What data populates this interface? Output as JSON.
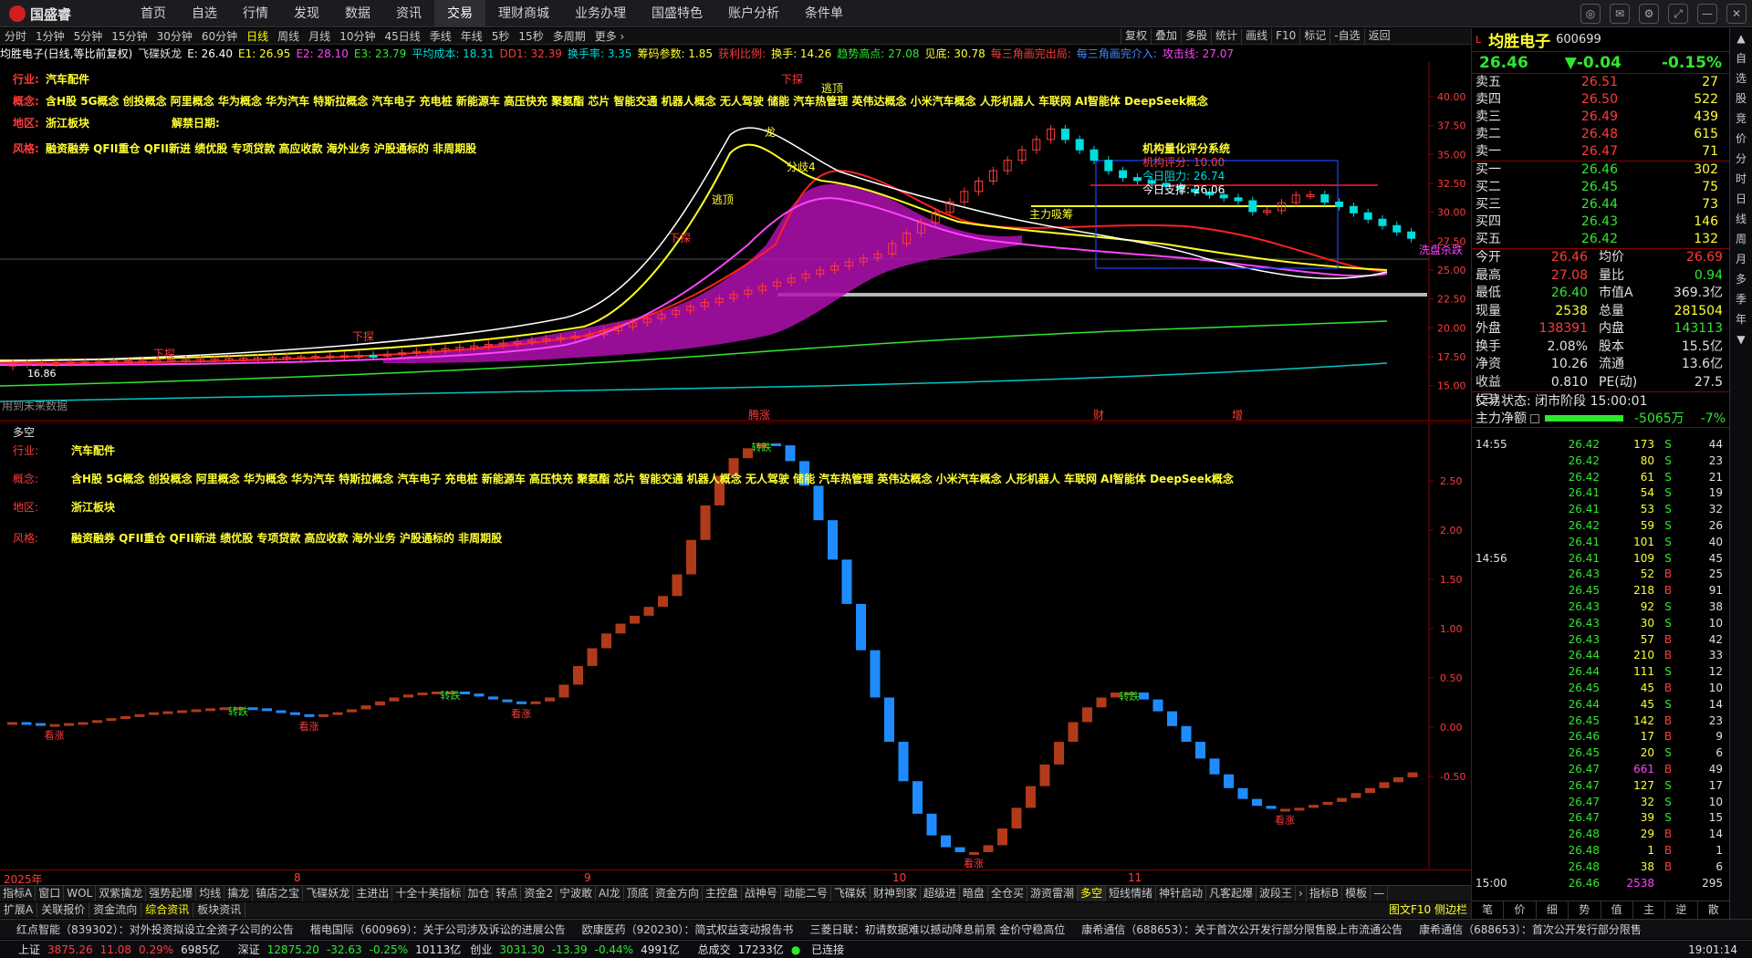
{
  "app": {
    "logo": "国盛睿"
  },
  "nav": {
    "items": [
      "首页",
      "自选",
      "行情",
      "发现",
      "数据",
      "资讯",
      "交易",
      "理财商城",
      "业务办理",
      "国盛特色",
      "账户分析",
      "条件单"
    ],
    "active_index": 6
  },
  "window_controls": [
    "◎",
    "✉",
    "⚙",
    "⤢",
    "—",
    "✕"
  ],
  "periods": {
    "items": [
      "分时",
      "1分钟",
      "5分钟",
      "15分钟",
      "30分钟",
      "60分钟",
      "日线",
      "周线",
      "月线",
      "10分钟",
      "45日线",
      "季线",
      "年线",
      "5秒",
      "15秒",
      "多周期",
      "更多 ›"
    ],
    "active_index": 6
  },
  "right_tools": [
    "复权",
    "叠加",
    "多股",
    "统计",
    "画线",
    "F10",
    "标记",
    "-自选",
    "返回"
  ],
  "indicator_line": [
    {
      "text": "均胜电子(日线,等比前复权)",
      "color": "#ffffff"
    },
    {
      "text": "飞碟妖龙",
      "color": "#e0e0e0"
    },
    {
      "text": "E: 26.40",
      "color": "#ffffff"
    },
    {
      "text": "E1: 26.95",
      "color": "#ffff33"
    },
    {
      "text": "E2: 28.10",
      "color": "#ff44ff"
    },
    {
      "text": "E3: 23.79",
      "color": "#2ee82e"
    },
    {
      "text": "平均成本: 18.31",
      "color": "#00dddd"
    },
    {
      "text": "DD1: 32.39",
      "color": "#ff3b3b"
    },
    {
      "text": "换手率: 3.35",
      "color": "#00dddd"
    },
    {
      "text": "筹码参数: 1.85",
      "color": "#ffff33"
    },
    {
      "text": "获利比例:",
      "color": "#ff3b3b"
    },
    {
      "text": "换手: 14.26",
      "color": "#ffff33"
    },
    {
      "text": "趋势高点: 27.08",
      "color": "#2ee82e"
    },
    {
      "text": "见底: 30.78",
      "color": "#ffff33"
    },
    {
      "text": "每三角画完出局:",
      "color": "#ff3b3b"
    },
    {
      "text": "每三角画完介入:",
      "color": "#4488ff"
    },
    {
      "text": "攻击线: 27.07",
      "color": "#ff44ff"
    }
  ],
  "info": {
    "industry_label": "行业:",
    "industry": "汽车配件",
    "concept_label": "概念:",
    "concepts": "含H股 5G概念 创投概念 阿里概念 华为概念 华为汽车 特斯拉概念 汽车电子 充电桩 新能源车 高压快充 聚氨酯 芯片 智能交通 机器人概念 无人驾驶 储能 汽车热管理 英伟达概念 小米汽车概念 人形机器人 车联网 AI智能体 DeepSeek概念",
    "region_label": "地区:",
    "region": "浙江板块",
    "unlock_label": "解禁日期:",
    "style_label": "风格:",
    "style": "融资融券 QFII重仓 QFII新进 绩优股 专项贷款 高应收款 海外业务 沪股通标的 非周期股"
  },
  "main_annotations": {
    "score_title": "机构量化评分系统",
    "score_line": "机构评分: 10.00",
    "resist": "今日阻力: 26.74",
    "support": "今日支撑: 26.06",
    "main_absorb": "主力吸筹",
    "wash": "洗盘杀跌",
    "no_data": "用到未来数据",
    "low_price": "16.86",
    "down_tag": "下探",
    "escape": "逃顶",
    "dragon": "龙",
    "divide": "分歧4",
    "limit_up": "涨停",
    "events": [
      "腾涨",
      "财",
      "增"
    ]
  },
  "main_axis": {
    "ticks": [
      40.0,
      37.5,
      35.0,
      32.5,
      30.0,
      27.5,
      25.0,
      22.5,
      20.0,
      17.5,
      15.0
    ],
    "labels": [
      "40.00",
      "37.50",
      "35.00",
      "32.50",
      "30.00",
      "27.50",
      "25.00",
      "22.50",
      "20.00",
      "17.50",
      "15.00"
    ]
  },
  "pane2": {
    "title": "多空",
    "axis_labels": [
      "2.50",
      "2.00",
      "1.50",
      "1.00",
      "0.50",
      "0.00",
      "-0.50"
    ],
    "bull_label": "转跌",
    "bear_label": "看涨"
  },
  "chart_data": {
    "type": "bar",
    "title": "多空",
    "x": [
      "2025年",
      "8",
      "9",
      "10",
      "11"
    ],
    "ylim": [
      -1.4,
      3.0
    ],
    "series": [
      {
        "values": [
          0.05,
          0.04,
          0.03,
          0.03,
          0.04,
          0.05,
          0.07,
          0.09,
          0.11,
          0.13,
          0.15,
          0.16,
          0.17,
          0.18,
          0.19,
          0.2,
          0.2,
          0.19,
          0.17,
          0.15,
          0.13,
          0.12,
          0.13,
          0.15,
          0.18,
          0.22,
          0.26,
          0.3,
          0.33,
          0.35,
          0.36,
          0.36,
          0.34,
          0.31,
          0.28,
          0.26,
          0.25,
          0.26,
          0.3,
          0.43,
          0.62,
          0.8,
          0.95,
          1.05,
          1.13,
          1.22,
          1.33,
          1.55,
          1.9,
          2.25,
          2.55,
          2.73,
          2.83,
          2.88,
          2.86,
          2.7,
          2.45,
          2.1,
          1.7,
          1.25,
          0.78,
          0.3,
          -0.15,
          -0.55,
          -0.88,
          -1.1,
          -1.22,
          -1.27,
          -1.27,
          -1.2,
          -1.03,
          -0.82,
          -0.6,
          -0.38,
          -0.15,
          0.05,
          0.2,
          0.3,
          0.35,
          0.35,
          0.28,
          0.16,
          0.01,
          -0.15,
          -0.32,
          -0.48,
          -0.62,
          -0.73,
          -0.8,
          -0.83,
          -0.83,
          -0.82,
          -0.79,
          -0.76,
          -0.72,
          -0.67,
          -0.62,
          -0.56,
          -0.51,
          -0.46
        ]
      }
    ]
  },
  "x_axis": {
    "labels": [
      "2025年",
      "8",
      "9",
      "10",
      "11"
    ]
  },
  "bottom_tabs1": {
    "items": [
      "指标A",
      "窗口",
      "WOL",
      "双紫擒龙",
      "强势起爆",
      "均线",
      "擒龙",
      "镇店之宝",
      "飞碟妖龙",
      "主进出",
      "十全十美指标",
      "加仓",
      "转点",
      "资金2",
      "宁波敢",
      "AI龙",
      "顶底",
      "资金方向",
      "主控盘",
      "战神号",
      "动能二号",
      "飞碟妖",
      "财神到家",
      "超级进",
      "暗盘",
      "全仓买",
      "游资雷潮",
      "多空",
      "短线情绪",
      "神针启动",
      "凡客起爆",
      "波段王",
      "›",
      "指标B",
      "模板",
      "—"
    ],
    "active_index": 27
  },
  "bottom_tabs2": {
    "items": [
      "扩展A",
      "关联报价",
      "资金流向",
      "综合资讯",
      "板块资讯"
    ],
    "active_index": 3,
    "right_text": "图文F10 侧边栏 «"
  },
  "news": [
    "红点智能（839302）：对外投资拟设立全资子公司的公告",
    "楷电国际（600969）：关于公司涉及诉讼的进展公告",
    "欧康医药（920230）：简式权益变动报告书",
    "三菱日联：初请数据难以撼动降息前景 金价守稳高位",
    "康希通信（688653）：关于首次公开发行部分限售股上市流通公告",
    "康希通信（688653）：首次公开发行部分限售"
  ],
  "status": {
    "sh_label": "上证",
    "sh_value": "3875.26",
    "sh_change": "11.08",
    "sh_pct": "0.29%",
    "sh_amount": "6985亿",
    "sz_label": "深证",
    "sz_value": "12875.20",
    "sz_change": "-32.63",
    "sz_pct": "-0.25%",
    "sz_amount": "10113亿",
    "cy_label": "创业",
    "cy_value": "3031.30",
    "cy_change": "-13.39",
    "cy_pct": "-0.44%",
    "cy_amount": "4991亿",
    "total_label": "总成交",
    "total_amount": "17233亿",
    "conn": "已连接",
    "time": "19:01:14"
  },
  "stock": {
    "name": "均胜电子",
    "code": "600699",
    "price": "26.46",
    "change": "▼-0.04",
    "pct": "-0.15%"
  },
  "orderbook": {
    "asks": [
      {
        "label": "卖五",
        "price": "26.51",
        "vol": "27"
      },
      {
        "label": "卖四",
        "price": "26.50",
        "vol": "522"
      },
      {
        "label": "卖三",
        "price": "26.49",
        "vol": "439"
      },
      {
        "label": "卖二",
        "price": "26.48",
        "vol": "615"
      },
      {
        "label": "卖一",
        "price": "26.47",
        "vol": "71"
      }
    ],
    "bids": [
      {
        "label": "买一",
        "price": "26.46",
        "vol": "302"
      },
      {
        "label": "买二",
        "price": "26.45",
        "vol": "75"
      },
      {
        "label": "买三",
        "price": "26.44",
        "vol": "73"
      },
      {
        "label": "买四",
        "price": "26.43",
        "vol": "146"
      },
      {
        "label": "买五",
        "price": "26.42",
        "vol": "132"
      }
    ]
  },
  "quote": [
    {
      "l1": "今开",
      "v1": "26.46",
      "c1": "#ff3b3b",
      "l2": "均价",
      "v2": "26.69",
      "c2": "#ff3b3b"
    },
    {
      "l1": "最高",
      "v1": "27.08",
      "c1": "#ff3b3b",
      "l2": "量比",
      "v2": "0.94",
      "c2": "#2ee82e"
    },
    {
      "l1": "最低",
      "v1": "26.40",
      "c1": "#2ee82e",
      "l2": "市值A",
      "v2": "369.3亿",
      "c2": "#e0e0e0"
    },
    {
      "l1": "现量",
      "v1": "2538",
      "c1": "#ffff33",
      "l2": "总量",
      "v2": "281504",
      "c2": "#ffff33"
    },
    {
      "l1": "外盘",
      "v1": "138391",
      "c1": "#ff3b3b",
      "l2": "内盘",
      "v2": "143113",
      "c2": "#2ee82e"
    },
    {
      "l1": "换手",
      "v1": "2.08%",
      "c1": "#e0e0e0",
      "l2": "股本",
      "v2": "15.5亿",
      "c2": "#e0e0e0"
    },
    {
      "l1": "净资",
      "v1": "10.26",
      "c1": "#e0e0e0",
      "l2": "流通",
      "v2": "13.6亿",
      "c2": "#e0e0e0"
    },
    {
      "l1": "收益(三)",
      "v1": "0.810",
      "c1": "#e0e0e0",
      "l2": "PE(动)",
      "v2": "27.5",
      "c2": "#e0e0e0"
    }
  ],
  "trade_state": "交易状态: 闭市阶段 15:00:01",
  "net_inflow": {
    "label": "主力净额",
    "value": "-5065万",
    "pct": "-7%"
  },
  "ticks": [
    {
      "t": "14:55",
      "p": "26.42",
      "v": "173",
      "bs": "S",
      "n": "44"
    },
    {
      "t": "",
      "p": "26.42",
      "v": "80",
      "bs": "S",
      "n": "23"
    },
    {
      "t": "",
      "p": "26.42",
      "v": "61",
      "bs": "S",
      "n": "21"
    },
    {
      "t": "",
      "p": "26.41",
      "v": "54",
      "bs": "S",
      "n": "19"
    },
    {
      "t": "",
      "p": "26.41",
      "v": "53",
      "bs": "S",
      "n": "32"
    },
    {
      "t": "",
      "p": "26.42",
      "v": "59",
      "bs": "S",
      "n": "26"
    },
    {
      "t": "",
      "p": "26.41",
      "v": "101",
      "bs": "S",
      "n": "40"
    },
    {
      "t": "14:56",
      "p": "26.41",
      "v": "109",
      "bs": "S",
      "n": "45"
    },
    {
      "t": "",
      "p": "26.43",
      "v": "52",
      "bs": "B",
      "n": "25"
    },
    {
      "t": "",
      "p": "26.45",
      "v": "218",
      "bs": "B",
      "n": "91"
    },
    {
      "t": "",
      "p": "26.43",
      "v": "92",
      "bs": "S",
      "n": "38"
    },
    {
      "t": "",
      "p": "26.43",
      "v": "30",
      "bs": "S",
      "n": "10"
    },
    {
      "t": "",
      "p": "26.43",
      "v": "57",
      "bs": "B",
      "n": "42"
    },
    {
      "t": "",
      "p": "26.44",
      "v": "210",
      "bs": "B",
      "n": "33"
    },
    {
      "t": "",
      "p": "26.44",
      "v": "111",
      "bs": "S",
      "n": "12"
    },
    {
      "t": "",
      "p": "26.45",
      "v": "45",
      "bs": "B",
      "n": "10"
    },
    {
      "t": "",
      "p": "26.44",
      "v": "45",
      "bs": "S",
      "n": "14"
    },
    {
      "t": "",
      "p": "26.45",
      "v": "142",
      "bs": "B",
      "n": "23"
    },
    {
      "t": "",
      "p": "26.46",
      "v": "17",
      "bs": "B",
      "n": "9"
    },
    {
      "t": "",
      "p": "26.45",
      "v": "20",
      "bs": "S",
      "n": "6"
    },
    {
      "t": "",
      "p": "26.47",
      "v": "661",
      "bs": "B",
      "n": "49"
    },
    {
      "t": "",
      "p": "26.47",
      "v": "127",
      "bs": "S",
      "n": "17"
    },
    {
      "t": "",
      "p": "26.47",
      "v": "32",
      "bs": "S",
      "n": "10"
    },
    {
      "t": "",
      "p": "26.47",
      "v": "39",
      "bs": "S",
      "n": "15"
    },
    {
      "t": "",
      "p": "26.48",
      "v": "29",
      "bs": "B",
      "n": "14"
    },
    {
      "t": "",
      "p": "26.48",
      "v": "1",
      "bs": "B",
      "n": "1"
    },
    {
      "t": "",
      "p": "26.48",
      "v": "38",
      "bs": "B",
      "n": "6"
    },
    {
      "t": "15:00",
      "p": "26.46",
      "v": "2538",
      "bs": "",
      "n": "295"
    }
  ],
  "rp_tabs": [
    "笔",
    "价",
    "细",
    "势",
    "值",
    "主",
    "逆",
    "散"
  ],
  "sidebar": [
    "▲",
    "自",
    "选",
    "股",
    "竞",
    "价",
    "分",
    "时",
    "日",
    "线",
    "周",
    "月",
    "多",
    "季",
    "年",
    "▼"
  ],
  "colors": {
    "up": "#ff3b3b",
    "down": "#2ee82e",
    "accent": "#ffff33",
    "cloud": "#b00fb0"
  }
}
